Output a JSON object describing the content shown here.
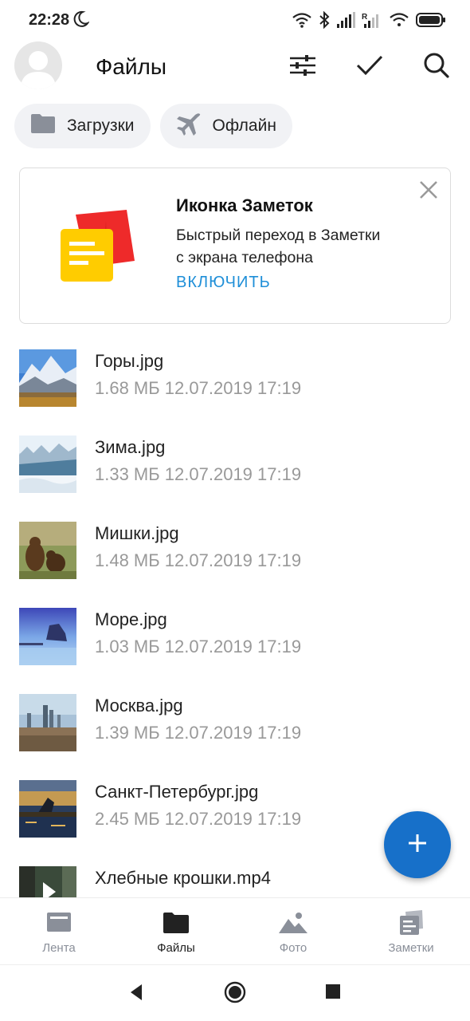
{
  "status_bar": {
    "time": "22:28",
    "icons": [
      "moon-icon",
      "wifi-icon",
      "bluetooth-icon",
      "signal-icon",
      "signal-r-icon",
      "wifi-hotspot-icon",
      "battery-icon"
    ]
  },
  "header": {
    "title": "Файлы",
    "icons": [
      "settings-sliders-icon",
      "checkmark-icon",
      "search-icon"
    ]
  },
  "chips": [
    {
      "label": "Загрузки",
      "icon": "folder-icon"
    },
    {
      "label": "Офлайн",
      "icon": "airplane-icon"
    }
  ],
  "promo": {
    "title": "Иконка Заметок",
    "text_line1": "Быстрый переход в Заметки",
    "text_line2": "с экрана телефона",
    "action": "ВКЛЮЧИТЬ",
    "icon": "notes-app-icon"
  },
  "files": [
    {
      "name": "Горы.jpg",
      "meta": "1.68 МБ 12.07.2019 17:19"
    },
    {
      "name": "Зима.jpg",
      "meta": "1.33 МБ 12.07.2019 17:19"
    },
    {
      "name": "Мишки.jpg",
      "meta": "1.48 МБ 12.07.2019 17:19"
    },
    {
      "name": "Море.jpg",
      "meta": "1.03 МБ 12.07.2019 17:19"
    },
    {
      "name": "Москва.jpg",
      "meta": "1.39 МБ 12.07.2019 17:19"
    },
    {
      "name": "Санкт-Петербург.jpg",
      "meta": "2.45 МБ 12.07.2019 17:19"
    },
    {
      "name": "Хлебные крошки.mp4",
      "meta": ""
    }
  ],
  "bottom_nav": [
    {
      "label": "Лента",
      "icon": "feed-icon",
      "active": false
    },
    {
      "label": "Файлы",
      "icon": "folder-icon",
      "active": true
    },
    {
      "label": "Фото",
      "icon": "photo-icon",
      "active": false
    },
    {
      "label": "Заметки",
      "icon": "notes-icon",
      "active": false
    }
  ],
  "colors": {
    "accent": "#1770c9",
    "link": "#1f8fd8",
    "secondary_text": "#999999",
    "nav_inactive": "#8a8f99"
  }
}
